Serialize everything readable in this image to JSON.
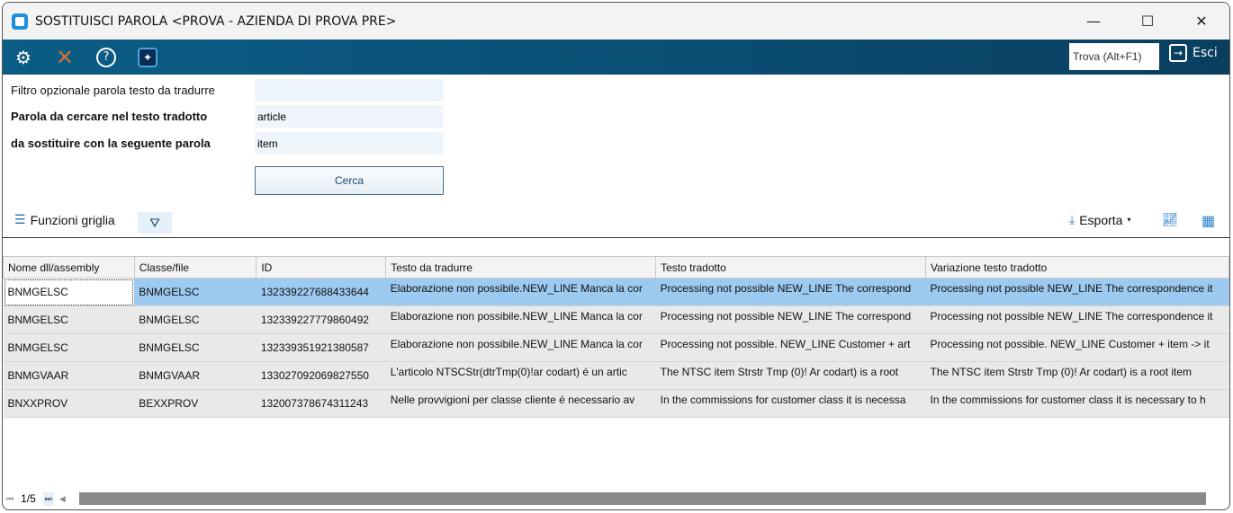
{
  "window": {
    "title": "SOSTITUISCI PAROLA <PROVA - AZIENDA DI PROVA PRE>",
    "minimize": "—",
    "maximize": "☐",
    "close": "✕"
  },
  "toolbar": {
    "find_label": "Trova (Alt+F1)",
    "exit_label": "Esci"
  },
  "form": {
    "filter_label": "Filtro opzionale parola testo da tradurre",
    "filter_value": "",
    "search_label": "Parola da cercare nel testo tradotto",
    "search_value": "article",
    "replace_label": "da sostituire con la seguente parola",
    "replace_value": "item",
    "search_button": "Cerca"
  },
  "grid_toolbar": {
    "functions_label": "Funzioni griglia",
    "export_label": "Esporta"
  },
  "grid": {
    "columns": [
      "Nome dll/assembly",
      "Classe/file",
      "ID",
      "Testo da tradurre",
      "Testo tradotto",
      "Variazione testo tradotto"
    ],
    "rows": [
      [
        "BNMGELSC",
        "BNMGELSC",
        "132339227688433644",
        "Elaborazione non possibile.NEW_LINE Manca la cor",
        "Processing not possible NEW_LINE The correspond",
        "Processing not possible NEW_LINE The correspondence it"
      ],
      [
        "BNMGELSC",
        "BNMGELSC",
        "132339227779860492",
        "Elaborazione non possibile.NEW_LINE Manca la cor",
        "Processing not possible NEW_LINE The correspond",
        "Processing not possible NEW_LINE The correspondence it"
      ],
      [
        "BNMGELSC",
        "BNMGELSC",
        "132339351921380587",
        "Elaborazione non possibile.NEW_LINE Manca la cor",
        "Processing not possible. NEW_LINE Customer + art",
        "Processing not possible. NEW_LINE Customer + item -> it"
      ],
      [
        "BNMGVAAR",
        "BNMGVAAR",
        "133027092069827550",
        "L'articolo NTSCStr(dtrTmp(0)!ar codart) é un artic",
        "The NTSC item Strstr Tmp (0)! Ar codart) is a root",
        "The NTSC item Strstr Tmp (0)! Ar codart) is a root item"
      ],
      [
        "BNXXPROV",
        "BEXXPROV",
        "132007378674311243",
        "Nelle provvigioni per classe cliente é necessario av",
        "In the commissions for customer class it is necessa",
        "In the commissions for customer class it is necessary to h"
      ]
    ]
  },
  "pager": {
    "page": "1/5"
  }
}
